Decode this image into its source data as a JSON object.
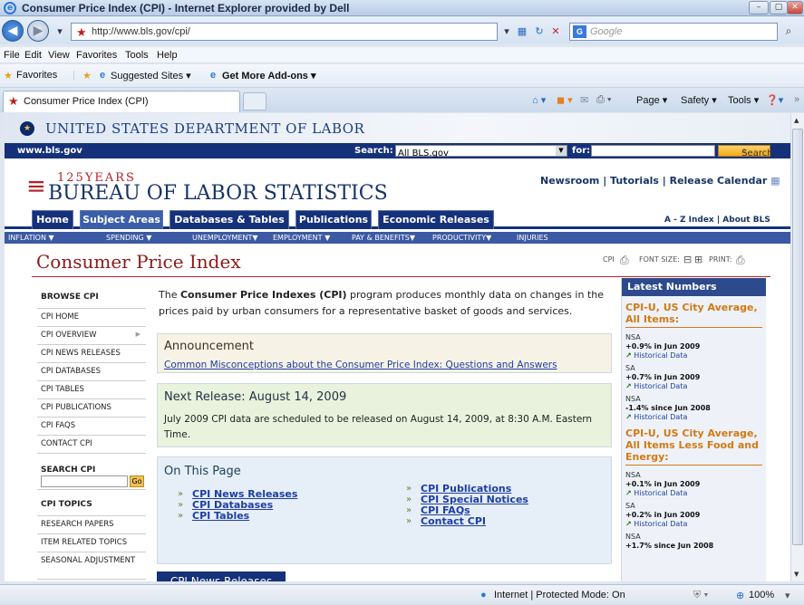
{
  "window": {
    "title": "Consumer Price Index (CPI) - Internet Explorer provided by Dell",
    "min": "–",
    "max": "▢",
    "close": "✕"
  },
  "address": {
    "url": "http://www.bls.gov/cpi/",
    "search_placeholder": "Google"
  },
  "menu": {
    "file": "File",
    "edit": "Edit",
    "view": "View",
    "favorites": "Favorites",
    "tools": "Tools",
    "help": "Help"
  },
  "favbar": {
    "favorites": "Favorites",
    "suggested": "Suggested Sites ▾",
    "addons": "Get More Add-ons ▾"
  },
  "tab": {
    "label": "Consumer Price Index (CPI)"
  },
  "cmdbar": {
    "page": "Page ▾",
    "safety": "Safety ▾",
    "tools": "Tools ▾"
  },
  "status": {
    "zone": "Internet | Protected Mode: On",
    "zoom": "100%"
  },
  "dol": {
    "name": "UNITED STATES DEPARTMENT OF LABOR",
    "site": "www.bls.gov",
    "search_label": "Search:",
    "search_select": "All BLS.gov",
    "for_label": "for:",
    "search_btn": "Search"
  },
  "bls": {
    "years": "125YEARS",
    "name": "BUREAU OF LABOR STATISTICS",
    "toplinks": "Newsroom | Tutorials | Release Calendar",
    "az": "A - Z Index | About BLS"
  },
  "nav_tabs": [
    "Home",
    "Subject Areas",
    "Databases & Tables",
    "Publications",
    "Economic Releases"
  ],
  "subnav": [
    "INFLATION ▼",
    "SPENDING ▼",
    "UNEMPLOYMENT▼",
    "EMPLOYMENT ▼",
    "PAY & BENEFITS▼",
    "PRODUCTIVITY▼",
    "INJURIES"
  ],
  "page": {
    "title": "Consumer Price Index",
    "cpi_print": "CPI",
    "font_size": "FONT SIZE:",
    "print": "PRINT:"
  },
  "left": {
    "browse_h": "BROWSE CPI",
    "browse": [
      "CPI HOME",
      "CPI OVERVIEW",
      "CPI NEWS RELEASES",
      "CPI DATABASES",
      "CPI TABLES",
      "CPI PUBLICATIONS",
      "CPI FAQS",
      "CONTACT CPI"
    ],
    "search_h": "SEARCH CPI",
    "go": "Go",
    "topics_h": "CPI TOPICS",
    "topics": [
      "RESEARCH PAPERS",
      "ITEM RELATED TOPICS",
      "SEASONAL ADJUSTMENT"
    ]
  },
  "main": {
    "intro_pre": "The ",
    "intro_bold": "Consumer Price Indexes (CPI)",
    "intro_post": " program produces monthly data on changes in the prices paid by urban consumers for a representative basket of goods and services.",
    "ann_h": "Announcement",
    "ann_link": "Common Misconceptions about the Consumer Price Index: Questions and Answers",
    "rel_h": "Next Release: August 14, 2009",
    "rel_text": "July 2009 CPI data are scheduled to be released on August 14, 2009, at 8:30 A.M. Eastern Time.",
    "otp_h": "On This Page",
    "otp_left": [
      "CPI News Releases",
      "CPI Databases",
      "CPI Tables"
    ],
    "otp_right": [
      "CPI Publications",
      "CPI Special Notices",
      "CPI FAQs",
      "Contact CPI"
    ],
    "bottom_tab": "CPI News Releases"
  },
  "latest": {
    "h": "Latest Numbers",
    "sec1": "CPI-U, US City Average, All Items:",
    "s1": [
      {
        "tag": "NSA",
        "val": "+0.9% in Jun 2009",
        "hist": "Historical Data"
      },
      {
        "tag": "SA",
        "val": "+0.7% in Jun 2009",
        "hist": "Historical Data"
      },
      {
        "tag": "NSA",
        "val": "-1.4% since Jun 2008",
        "hist": "Historical Data"
      }
    ],
    "sec2": "CPI-U, US City Average, All Items Less Food and Energy:",
    "s2": [
      {
        "tag": "NSA",
        "val": "+0.1% in Jun 2009",
        "hist": "Historical Data"
      },
      {
        "tag": "SA",
        "val": "+0.2% in Jun 2009",
        "hist": "Historical Data"
      },
      {
        "tag": "NSA",
        "val": "+1.7% since Jun 2008",
        "hist": ""
      }
    ]
  }
}
